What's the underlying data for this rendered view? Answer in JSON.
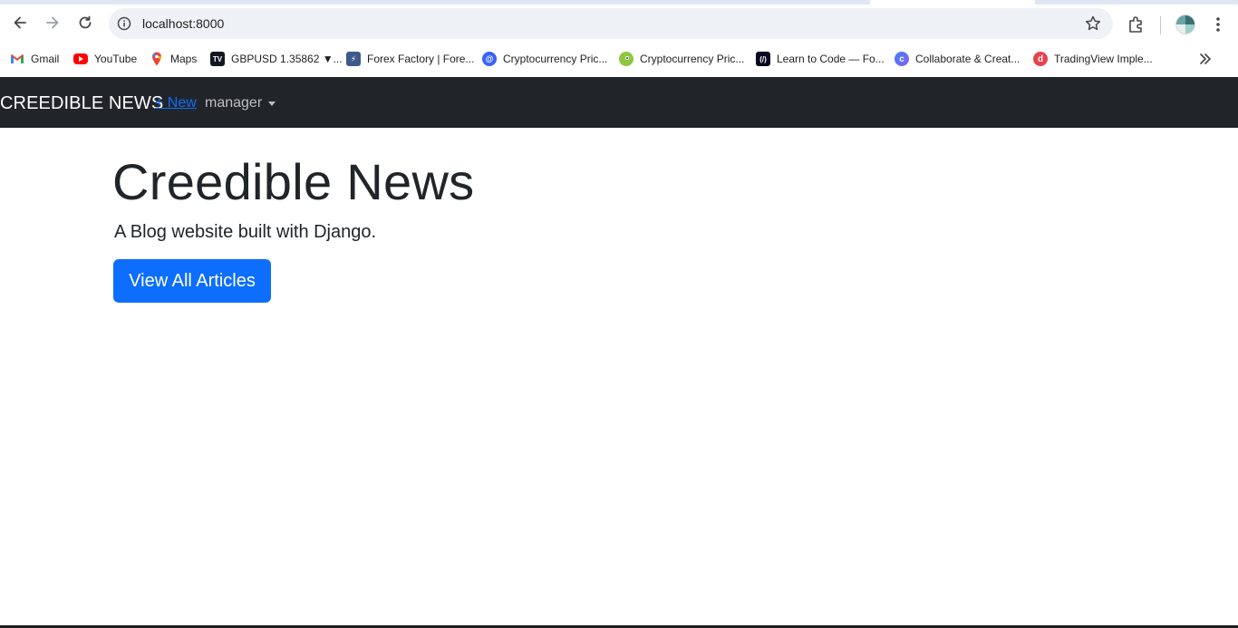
{
  "browser": {
    "url": "localhost:8000",
    "icons": {
      "back": "back-arrow-icon",
      "forward": "forward-arrow-icon",
      "reload": "reload-icon",
      "site_info": "info-icon",
      "bookmark": "star-icon",
      "extensions": "puzzle-icon",
      "profile": "avatar",
      "menu": "kebab-menu-icon",
      "more_bookmarks": "chevron-double-right-icon"
    }
  },
  "bookmarks": [
    {
      "label": "Gmail",
      "icon": "gmail-icon"
    },
    {
      "label": "YouTube",
      "icon": "youtube-icon"
    },
    {
      "label": "Maps",
      "icon": "maps-icon"
    },
    {
      "label": "GBPUSD 1.35862 ▼...",
      "icon": "tradingview-icon"
    },
    {
      "label": "Forex Factory | Fore...",
      "icon": "forex-factory-icon"
    },
    {
      "label": "Cryptocurrency Pric...",
      "icon": "coinmarketcap-icon"
    },
    {
      "label": "Cryptocurrency Pric...",
      "icon": "coingecko-icon"
    },
    {
      "label": "Learn to Code — Fo...",
      "icon": "freecodecamp-icon"
    },
    {
      "label": "Collaborate & Creat...",
      "icon": "collab-icon"
    },
    {
      "label": "TradingView Imple...",
      "icon": "tradingview-impl-icon"
    }
  ],
  "navbar": {
    "brand": "CREEDIBLE NEWS",
    "new_link": "+ New",
    "user_menu": "manager"
  },
  "hero": {
    "title": "Creedible News",
    "lead": "A Blog website built with Django.",
    "button": "View All Articles"
  },
  "colors": {
    "navbar_bg": "#212529",
    "primary": "#0d6efd",
    "text": "#212529",
    "omnibox_bg": "#eef1f6"
  }
}
